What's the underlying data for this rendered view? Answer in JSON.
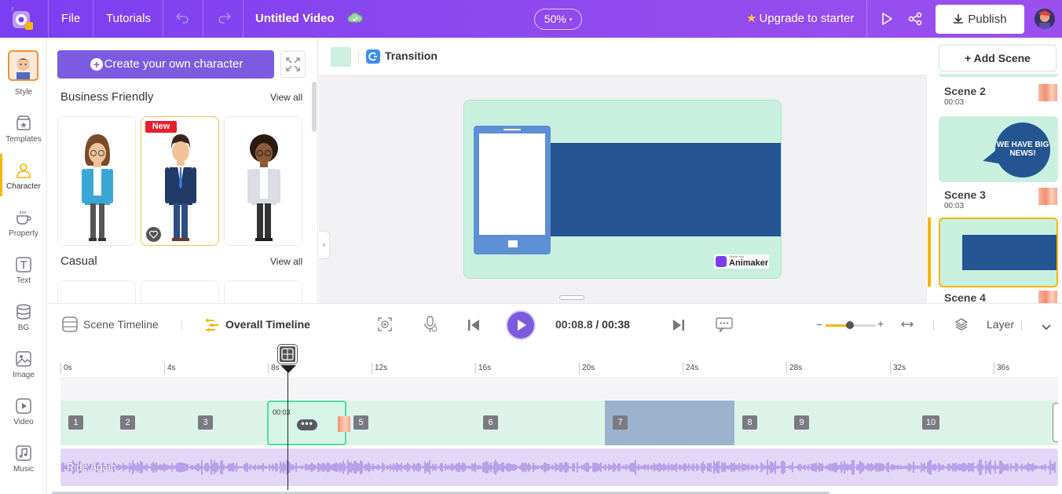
{
  "topbar": {
    "file_label": "File",
    "tutorials_label": "Tutorials",
    "project_title": "Untitled Video",
    "zoom_label": "50%",
    "upgrade_label": "Upgrade to starter",
    "publish_label": "Publish"
  },
  "rail": {
    "items": [
      {
        "label": "Style",
        "icon": "avatar-icon"
      },
      {
        "label": "Templates",
        "icon": "templates-icon"
      },
      {
        "label": "Character",
        "icon": "person-icon"
      },
      {
        "label": "Property",
        "icon": "cup-icon"
      },
      {
        "label": "Text",
        "icon": "text-icon"
      },
      {
        "label": "BG",
        "icon": "layers-icon"
      },
      {
        "label": "Image",
        "icon": "image-icon"
      },
      {
        "label": "Video",
        "icon": "video-icon"
      },
      {
        "label": "Music",
        "icon": "music-icon"
      }
    ],
    "active": "Character"
  },
  "panel": {
    "create_label": "Create your own character",
    "sections": [
      {
        "title": "Business Friendly",
        "view_all": "View all"
      },
      {
        "title": "Casual",
        "view_all": "View all"
      }
    ],
    "new_badge": "New"
  },
  "stage": {
    "transition_label": "Transition",
    "watermark_small": "Made with",
    "watermark_brand": "Animaker"
  },
  "scenes": {
    "add_label": "+ Add Scene",
    "items": [
      {
        "name": "Scene 2",
        "duration": "00:03"
      },
      {
        "name": "Scene 3",
        "duration": "00:03"
      },
      {
        "name": "Scene 4",
        "duration": ""
      }
    ],
    "bubble_text": "WE HAVE BIG NEWS!"
  },
  "timeline": {
    "scene_timeline_label": "Scene Timeline",
    "overall_timeline_label": "Overall Timeline",
    "current_time": "00:08.8",
    "separator": "/",
    "total_time": "00:38",
    "layer_label": "Layer",
    "ruler": [
      "0s",
      "4s",
      "8s",
      "12s",
      "16s",
      "20s",
      "24s",
      "28s",
      "32s",
      "36s"
    ],
    "scene_numbers": [
      "1",
      "2",
      "3",
      "5",
      "6",
      "7",
      "8",
      "9",
      "10"
    ],
    "selected_duration": "00:03",
    "audio_name": "Ride Again",
    "zoom_level": 0.45
  },
  "colors": {
    "brand_purple": "#7b3ef0",
    "accent_yellow": "#f7b500",
    "canvas_green": "#c9f0de",
    "banner_blue": "#245492"
  }
}
